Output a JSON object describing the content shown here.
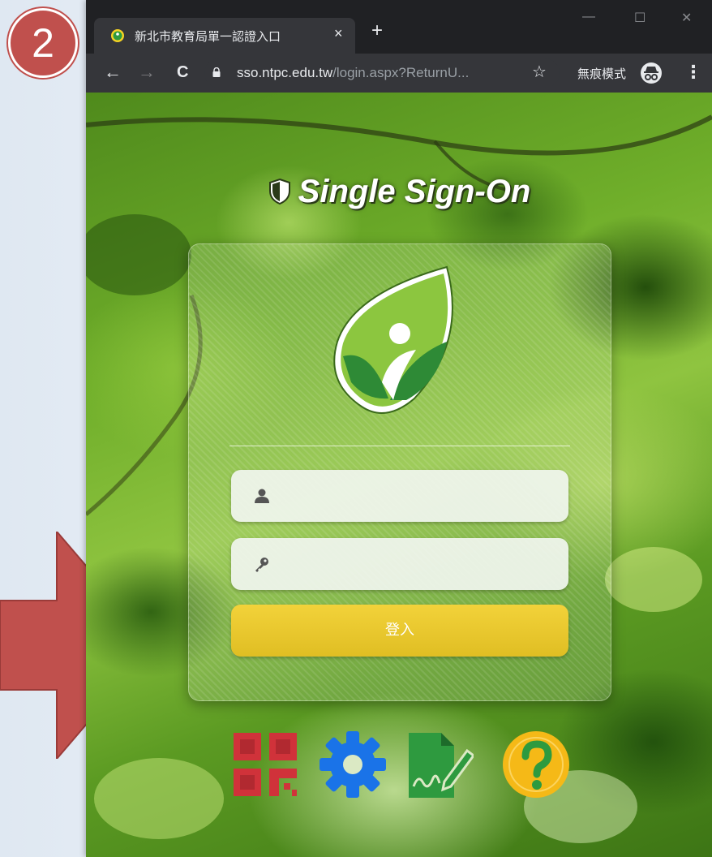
{
  "step_badge": {
    "number": "2"
  },
  "browser": {
    "tab": {
      "title": "新北市教育局單一認證入口",
      "close_glyph": "×"
    },
    "new_tab_glyph": "+",
    "window_controls": {
      "minimize": "—",
      "maximize": "☐",
      "close": "✕"
    },
    "toolbar": {
      "back_glyph": "←",
      "forward_glyph": "→",
      "reload_glyph": "C",
      "url_host": "sso.ntpc.edu.tw",
      "url_rest": "/login.aspx?ReturnU...",
      "bookmark_glyph": "☆",
      "incognito_label": "無痕模式",
      "menu_glyph": "⋮"
    }
  },
  "page": {
    "title": "Single Sign-On",
    "username": {
      "value": "",
      "placeholder": ""
    },
    "password": {
      "value": "",
      "placeholder": ""
    },
    "login_label": "登入",
    "bottom_icons": [
      "qr-code-icon",
      "gear-icon",
      "signature-document-icon",
      "help-icon"
    ]
  },
  "colors": {
    "badge": "#c0504d",
    "arrow": "#c0504d",
    "login_button": "#e8c62c",
    "help_icon": "#f5b917",
    "gear_icon": "#1a73e8",
    "qr_icon": "#d0323a",
    "doc_icon": "#2e9a3f"
  }
}
